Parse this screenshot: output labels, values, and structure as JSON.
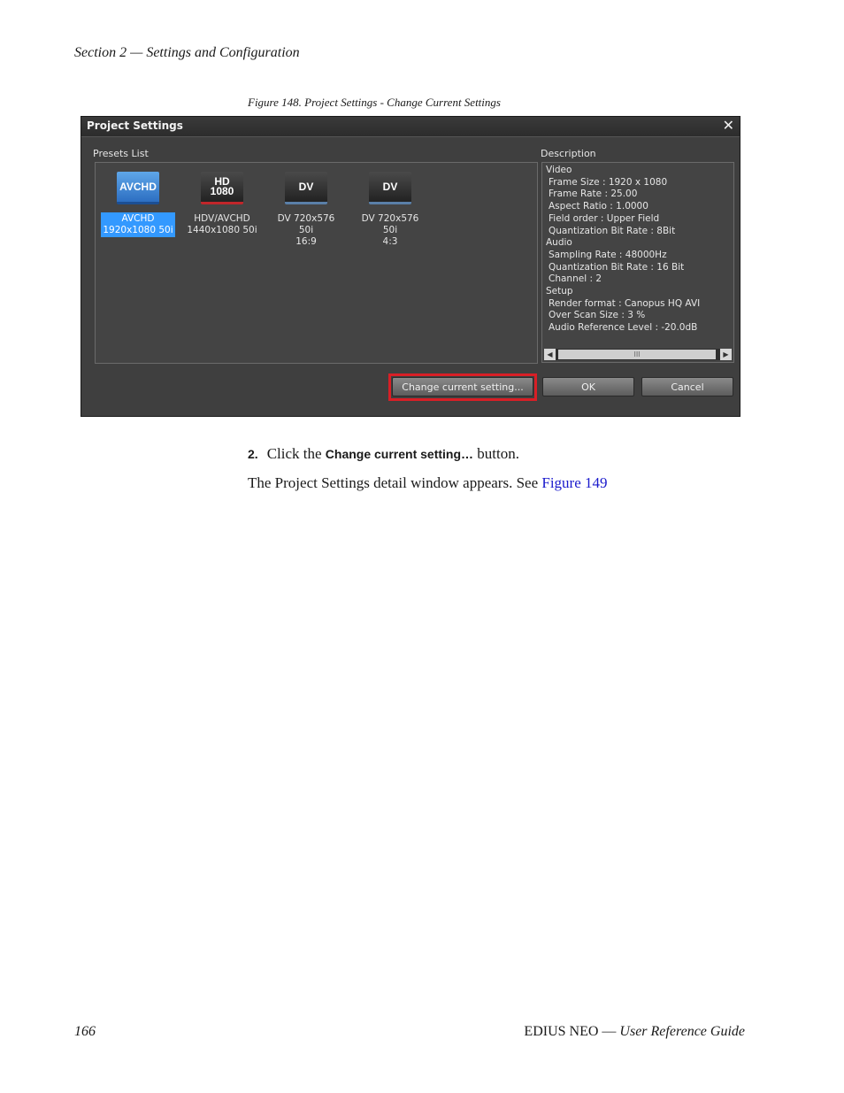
{
  "header": {
    "section": "Section 2 — Settings and Configuration"
  },
  "figure": {
    "caption": "Figure 148.  Project Settings - Change Current Settings"
  },
  "dialog": {
    "title": "Project Settings",
    "close": "✕",
    "presets_label": "Presets List",
    "description_label": "Description",
    "presets": [
      {
        "icon_text": "AVCHD",
        "line1": "AVCHD",
        "line2": "1920x1080 50i",
        "selected": true
      },
      {
        "icon_text_1": "HD",
        "icon_text_2": "1080",
        "line1": "HDV/AVCHD",
        "line2": "1440x1080 50i",
        "selected": false
      },
      {
        "icon_text": "DV",
        "line1": "DV 720x576 50i",
        "line2": "16:9",
        "selected": false
      },
      {
        "icon_text": "DV",
        "line1": "DV 720x576 50i",
        "line2": "4:3",
        "selected": false
      }
    ],
    "description": {
      "video": "Video",
      "frame_size": "Frame Size : 1920 x 1080",
      "frame_rate": "Frame Rate : 25.00",
      "aspect_ratio": "Aspect Ratio : 1.0000",
      "field_order": "Field order : Upper Field",
      "video_qbr": "Quantization Bit Rate : 8Bit",
      "audio": "Audio",
      "sampling_rate": "Sampling Rate : 48000Hz",
      "audio_qbr": "Quantization Bit Rate : 16 Bit",
      "channel": "Channel : 2",
      "setup": "Setup",
      "render_format": "Render format : Canopus HQ AVI",
      "over_scan": "Over Scan Size : 3 %",
      "audio_ref": "Audio Reference Level : -20.0dB"
    },
    "scroll_thumb": "III",
    "buttons": {
      "change": "Change current setting...",
      "ok": "OK",
      "cancel": "Cancel"
    }
  },
  "step": {
    "number": "2.",
    "pre": "Click the ",
    "command": "Change current setting…",
    "post": " button."
  },
  "paragraph": {
    "text": "The Project Settings detail window appears. See ",
    "link": "Figure 149"
  },
  "footer": {
    "page": "166",
    "product": "EDIUS NEO",
    "sep": " — ",
    "guide": "User Reference Guide"
  }
}
